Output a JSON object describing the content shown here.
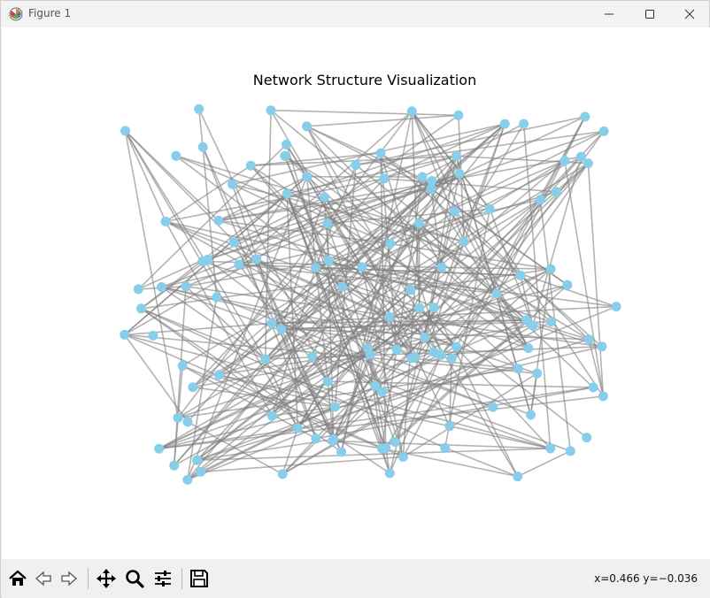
{
  "window": {
    "title": "Figure 1",
    "icons": {
      "app": "matplotlib-figure-icon",
      "minimize": "minimize-icon",
      "maximize": "maximize-icon",
      "close": "close-icon"
    }
  },
  "figure": {
    "title": "Network Structure Visualization",
    "node_color": "#87ceeb",
    "edge_color": "#808080"
  },
  "chart_data": {
    "type": "network",
    "title": "Network Structure Visualization",
    "axes_visible": false,
    "node_count": 124,
    "node_color": "#87ceeb",
    "edge_color": "#808080"
  },
  "toolbar": {
    "buttons": [
      {
        "name": "home-button",
        "icon": "home-icon"
      },
      {
        "name": "back-button",
        "icon": "back-arrow-icon"
      },
      {
        "name": "forward-button",
        "icon": "forward-arrow-icon"
      },
      {
        "name": "pan-button",
        "icon": "pan-move-icon"
      },
      {
        "name": "zoom-button",
        "icon": "zoom-magnifier-icon"
      },
      {
        "name": "configure-subplots-button",
        "icon": "sliders-icon"
      },
      {
        "name": "save-button",
        "icon": "save-disk-icon"
      }
    ],
    "coordinates": "x=0.466 y=−0.036"
  }
}
